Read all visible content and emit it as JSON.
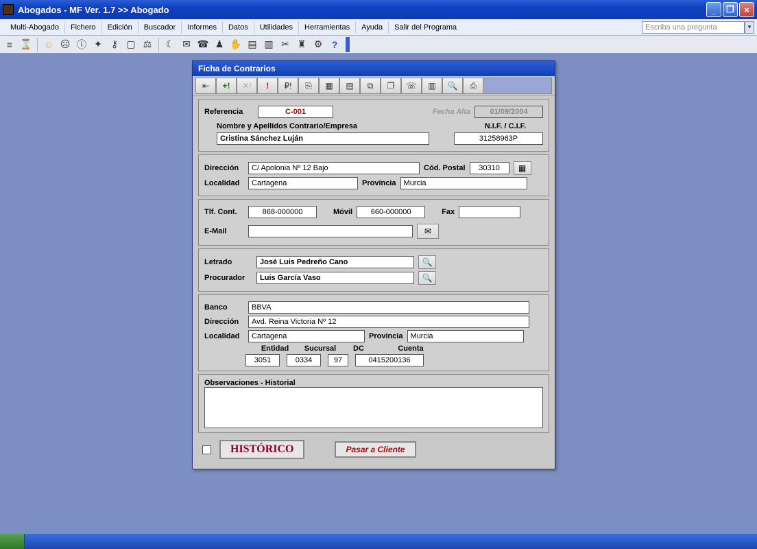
{
  "window": {
    "title": "Abogados - MF  Ver. 1.7 >> Abogado"
  },
  "menu": {
    "items": [
      "Multi-Abogado",
      "Fichero",
      "Edición",
      "Buscador",
      "Informes",
      "Datos",
      "Utilidades",
      "Herramientas",
      "Ayuda",
      "Salir del Programa"
    ],
    "ask_placeholder": "Escriba una pregunta"
  },
  "dialog": {
    "title": "Ficha de Contrarios",
    "ref_label": "Referencia",
    "ref_value": "C-001",
    "fecha_label": "Fecha Alta",
    "fecha_value": "01/09/2004",
    "nombre_label": "Nombre  y Apellidos Contrario/Empresa",
    "nif_label": "N.I.F. / C.I.F.",
    "nombre_value": "Cristina Sánchez Luján",
    "nif_value": "31258963P",
    "dir_label": "Dirección",
    "dir_value": "C/ Apolonia Nº 12 Bajo",
    "cp_label": "Cód. Postal",
    "cp_value": "30310",
    "loc_label": "Localidad",
    "loc_value": "Cartagena",
    "prov_label": "Provincia",
    "prov_value": "Murcia",
    "tlf_label": "Tlf. Cont.",
    "tlf_value": "868-000000",
    "movil_label": "Móvil",
    "movil_value": "660-000000",
    "fax_label": "Fax",
    "fax_value": "",
    "email_label": "E-Mail",
    "email_value": "",
    "letrado_label": "Letrado",
    "letrado_value": "José Luis Pedreño Cano",
    "procurador_label": "Procurador",
    "procurador_value": "Luis García Vaso",
    "banco_label": "Banco",
    "banco_value": "BBVA",
    "bdir_label": "Dirección",
    "bdir_value": "Avd. Reina Victoria Nº 12",
    "bloc_label": "Localidad",
    "bloc_value": "Cartagena",
    "bprov_label": "Provincia",
    "bprov_value": "Murcia",
    "entidad_label": "Entidad",
    "entidad_value": "3051",
    "sucursal_label": "Sucursal",
    "sucursal_value": "0334",
    "dc_label": "DC",
    "dc_value": "97",
    "cuenta_label": "Cuenta",
    "cuenta_value": "0415200136",
    "obs_label": "Observaciones - Historial",
    "historico_label": "HISTÓRICO",
    "pasar_label": "Pasar a Cliente"
  }
}
